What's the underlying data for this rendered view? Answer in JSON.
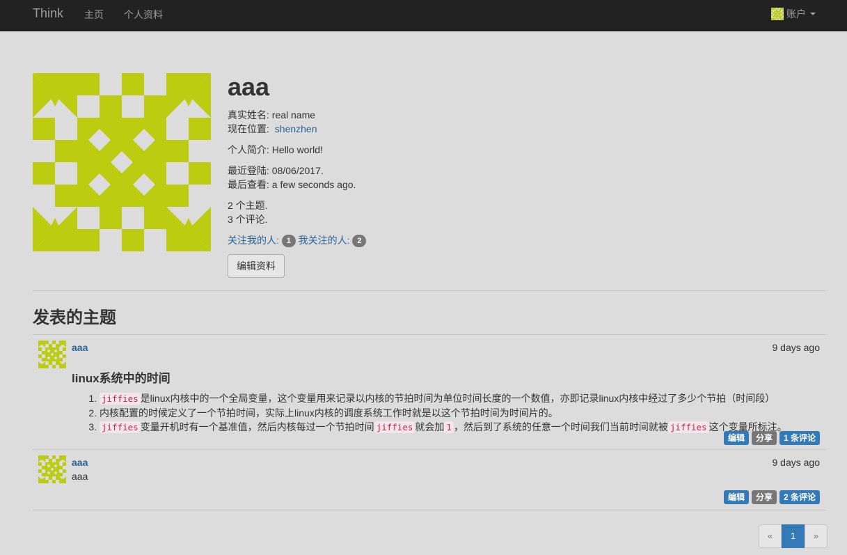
{
  "navbar": {
    "brand": "Think",
    "links": [
      "主页",
      "个人资料"
    ],
    "account_label": "账户",
    "avatar": "identicon-avatar"
  },
  "profile": {
    "avatar": "identicon-avatar",
    "username": "aaa",
    "real_name_label": "真实姓名:",
    "real_name": "real name",
    "location_label": "现在位置:",
    "location": "shenzhen",
    "bio_label": "个人简介:",
    "bio": "Hello world!",
    "last_login_label": "最近登陆:",
    "last_login": "08/06/2017.",
    "last_seen_label": "最后查看:",
    "last_seen": "a few seconds ago.",
    "topics_count": "2 个主题.",
    "comments_count": "3 个评论.",
    "followers_label": "关注我的人:",
    "followers_count": "1",
    "following_label": "我关注的人:",
    "following_count": "2",
    "edit_button": "编辑资料"
  },
  "posts_section": {
    "title": "发表的主题",
    "posts": [
      {
        "author": "aaa",
        "time": "9 days ago",
        "heading": "linux系统中的时间",
        "items": [
          {
            "code1": "jiffies",
            "text1": "是linux内核中的一个全局变量，这个变量用来记录以内核的节拍时间为单位时间长度的一个数值，亦即记录linux内核中经过了多少个节拍（时间段）"
          },
          {
            "text1": "内核配置的时候定义了一个节拍时间，实际上linux内核的调度系统工作时就是以这个节拍时间为时间片的。"
          },
          {
            "code1": "jiffies",
            "text1": "变量开机时有一个基准值，然后内核每过一个节拍时间",
            "code2": "jiffies",
            "text2": "就会加",
            "code3": "1",
            "text3": "，然后到了系统的任意一个时间我们当前时间就被",
            "code4": "jiffies",
            "text4": "这个变量所标注。"
          }
        ],
        "edit_label": "编辑",
        "share_label": "分享",
        "comments_label": "1 条评论"
      },
      {
        "author": "aaa",
        "time": "9 days ago",
        "body": "aaa",
        "edit_label": "编辑",
        "share_label": "分享",
        "comments_label": "2 条评论"
      }
    ]
  },
  "pagination": {
    "prev": "«",
    "current": "1",
    "next": "»"
  },
  "colors": {
    "identicon": "#bccd11",
    "navbar_bg": "#222222",
    "page_bg": "#dcdcdc",
    "primary": "#337ab7"
  }
}
